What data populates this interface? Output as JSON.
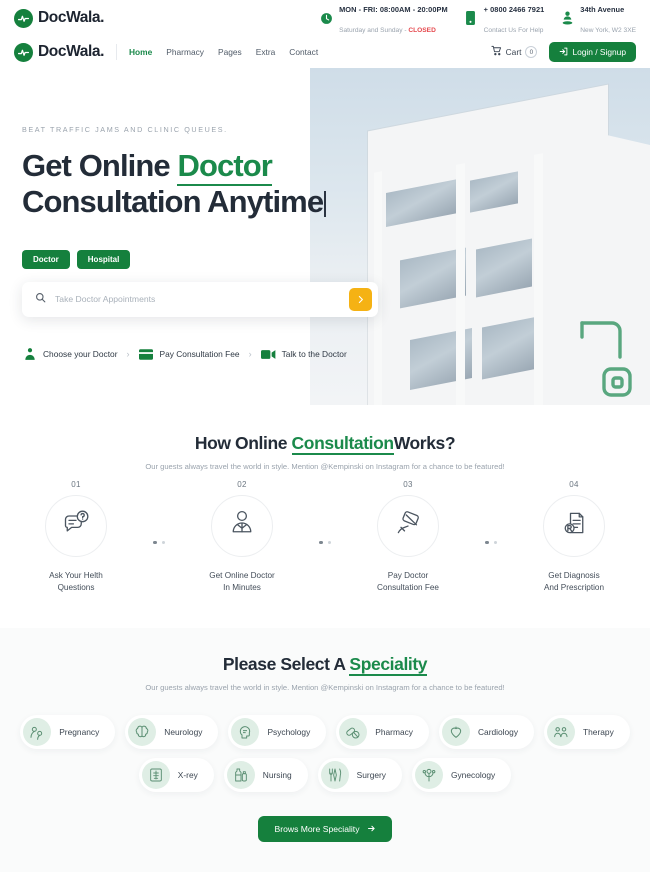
{
  "brand": {
    "name": "DocWala.",
    "logo_icon": "pulse-circle-icon",
    "color": "#15803d"
  },
  "topbar": {
    "contacts": [
      {
        "icon": "clock-icon",
        "line1": "MON - FRI: 08:00AM - 20:00PM",
        "line2_prefix": "Saturday and Sunday - ",
        "line2_status": "CLOSED"
      },
      {
        "icon": "phone-icon",
        "line1": "+ 0800 2466 7921",
        "line2": "Contact Us For Help"
      },
      {
        "icon": "location-pin-icon",
        "line1": "34th Avenue",
        "line2": "New York, W2 3XE"
      }
    ]
  },
  "nav": {
    "links": [
      {
        "label": "Home",
        "active": true
      },
      {
        "label": "Pharmacy",
        "active": false
      },
      {
        "label": "Pages",
        "active": false
      },
      {
        "label": "Extra",
        "active": false
      },
      {
        "label": "Contact",
        "active": false
      }
    ],
    "cart": {
      "label": "Cart",
      "count": "0",
      "icon": "cart-icon"
    },
    "login": {
      "label": "Login / Signup",
      "icon": "login-icon"
    }
  },
  "hero": {
    "eyebrow": "BEAT TRAFFIC JAMS AND CLINIC QUEUES.",
    "headline_1": "Get Online ",
    "headline_accent": "Doctor",
    "headline_2": "Consultation Anytime",
    "tabs": [
      {
        "label": "Doctor"
      },
      {
        "label": "Hospital"
      }
    ],
    "search": {
      "placeholder": "Take Doctor Appointments",
      "value": "",
      "icon": "search-icon",
      "submit_icon": "chevron-right-icon",
      "submit_color": "#f5b214"
    },
    "steps_inline": [
      {
        "icon": "doctor-icon",
        "label": "Choose your Doctor"
      },
      {
        "icon": "credit-card-icon",
        "label": "Pay Consultation Fee"
      },
      {
        "icon": "video-camera-icon",
        "label": "Talk to the Doctor"
      }
    ],
    "separator": "›",
    "image_alt": "modern-white-building-photo"
  },
  "how_it_works": {
    "title_1": "How Online ",
    "title_accent": "Consultation",
    "title_2": "Works?",
    "subtitle": "Our guests always travel the world in style. Mention @Kempinski on Instagram for a chance to be featured!",
    "steps": [
      {
        "num": "01",
        "icon": "chat-question-icon",
        "line1": "Ask Your Helth",
        "line2": "Questions"
      },
      {
        "num": "02",
        "icon": "doctor-person-icon",
        "line1": "Get Online Doctor",
        "line2": "In Minutes"
      },
      {
        "num": "03",
        "icon": "hand-card-icon",
        "line1": "Pay Doctor",
        "line2": "Consultation Fee"
      },
      {
        "num": "04",
        "icon": "prescription-icon",
        "line1": "Get Diagnosis",
        "line2": "And Prescription"
      }
    ]
  },
  "speciality": {
    "title_1": "Please Select A ",
    "title_accent": "Speciality",
    "subtitle": "Our guests always travel the world in style. Mention @Kempinski on Instagram for a chance to be featured!",
    "items": [
      {
        "label": "Pregnancy",
        "icon": "pregnancy-icon"
      },
      {
        "label": "Neurology",
        "icon": "brain-icon"
      },
      {
        "label": "Psychology",
        "icon": "psychology-head-icon"
      },
      {
        "label": "Pharmacy",
        "icon": "pills-icon"
      },
      {
        "label": "Cardiology",
        "icon": "heart-icon"
      },
      {
        "label": "Therapy",
        "icon": "therapy-group-icon"
      },
      {
        "label": "X-rey",
        "icon": "xray-icon"
      },
      {
        "label": "Nursing",
        "icon": "nursing-bottle-icon"
      },
      {
        "label": "Surgery",
        "icon": "surgery-tools-icon"
      },
      {
        "label": "Gynecology",
        "icon": "gynecology-icon"
      }
    ],
    "browse_button": {
      "label": "Brows More Speciality",
      "icon": "arrow-right-icon"
    }
  }
}
